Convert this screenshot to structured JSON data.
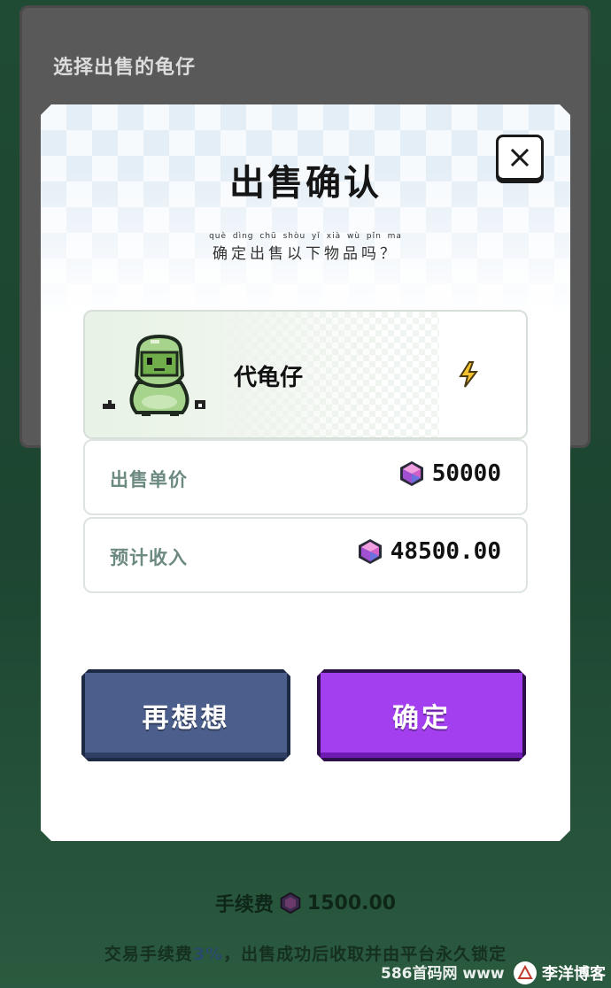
{
  "background": {
    "panel_title": "选择出售的龟仔",
    "fee_label": "手续费",
    "fee_value": "1500.00",
    "fee_note_prefix": "交易手续费",
    "fee_note_percent": "3%",
    "fee_note_suffix": "，出售成功后收取并由平台永久锁定"
  },
  "dialog": {
    "title": "出售确认",
    "close_icon": "close-icon",
    "pinyin": "què dìng chū shòu yǐ xià wù pǐn ma",
    "subtitle": "确定出售以下物品吗？",
    "item": {
      "name": "代龟仔",
      "image_icon": "turtle-sprite",
      "badge_icon": "lightning-icon"
    },
    "rows": [
      {
        "label": "出售单价",
        "value": "50000",
        "icon": "gem-icon"
      },
      {
        "label": "预计收入",
        "value": "48500.00",
        "icon": "gem-icon"
      }
    ],
    "buttons": {
      "cancel": "再想想",
      "confirm": "确定"
    }
  },
  "watermark": {
    "left_text": "586首码网 www",
    "right_text": "李洋博客"
  },
  "colors": {
    "cancel_button": "#4c5f8c",
    "confirm_button": "#a43ff0",
    "label_text": "#6d8a82",
    "background": "#1f4a33"
  }
}
